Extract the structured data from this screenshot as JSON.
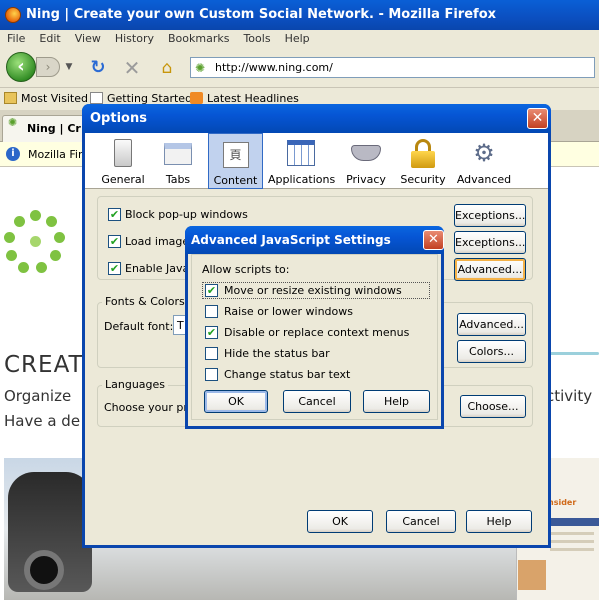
{
  "browser": {
    "title": "Ning | Create your own Custom Social Network. - Mozilla Firefox",
    "menu": [
      "File",
      "Edit",
      "View",
      "History",
      "Bookmarks",
      "Tools",
      "Help"
    ],
    "url": "http://www.ning.com/",
    "bookmarks": [
      "Most Visited",
      "Getting Started",
      "Latest Headlines"
    ],
    "tab_label": "Ning | Cr",
    "infobar_text": "Mozilla Fire"
  },
  "page": {
    "heading": "CREAT",
    "line1": "Organize",
    "line2": "Have a de",
    "line1_right": "ctivity",
    "thumb_title": "nsider"
  },
  "options_dialog": {
    "title": "Options",
    "close": "✕",
    "panes": [
      {
        "label": "General",
        "icon": "switch-icon"
      },
      {
        "label": "Tabs",
        "icon": "tabs-icon"
      },
      {
        "label": "Content",
        "icon": "content-icon",
        "selected": true
      },
      {
        "label": "Applications",
        "icon": "applications-icon"
      },
      {
        "label": "Privacy",
        "icon": "mask-icon"
      },
      {
        "label": "Security",
        "icon": "padlock-icon"
      },
      {
        "label": "Advanced",
        "icon": "gear-icon"
      }
    ],
    "block_popups": "Block pop-up windows",
    "load_images": "Load images",
    "enable_js": "Enable Java",
    "exceptions_label": "Exceptions...",
    "advanced_label": "Advanced...",
    "fonts_group": "Fonts & Colors",
    "default_font_label": "Default font:",
    "default_font_value": "T",
    "fonts_advanced_label": "Advanced...",
    "colors_label": "Colors...",
    "languages_group": "Languages",
    "languages_text": "Choose your pre",
    "choose_label": "Choose...",
    "ok": "OK",
    "cancel": "Cancel",
    "help": "Help"
  },
  "advanced_js_dialog": {
    "title": "Advanced JavaScript Settings",
    "close": "✕",
    "allow_label": "Allow scripts to:",
    "options": [
      {
        "label": "Move or resize existing windows",
        "checked": true
      },
      {
        "label": "Raise or lower windows",
        "checked": false
      },
      {
        "label": "Disable or replace context menus",
        "checked": true
      },
      {
        "label": "Hide the status bar",
        "checked": false
      },
      {
        "label": "Change status bar text",
        "checked": false
      }
    ],
    "ok": "OK",
    "cancel": "Cancel",
    "help": "Help"
  }
}
